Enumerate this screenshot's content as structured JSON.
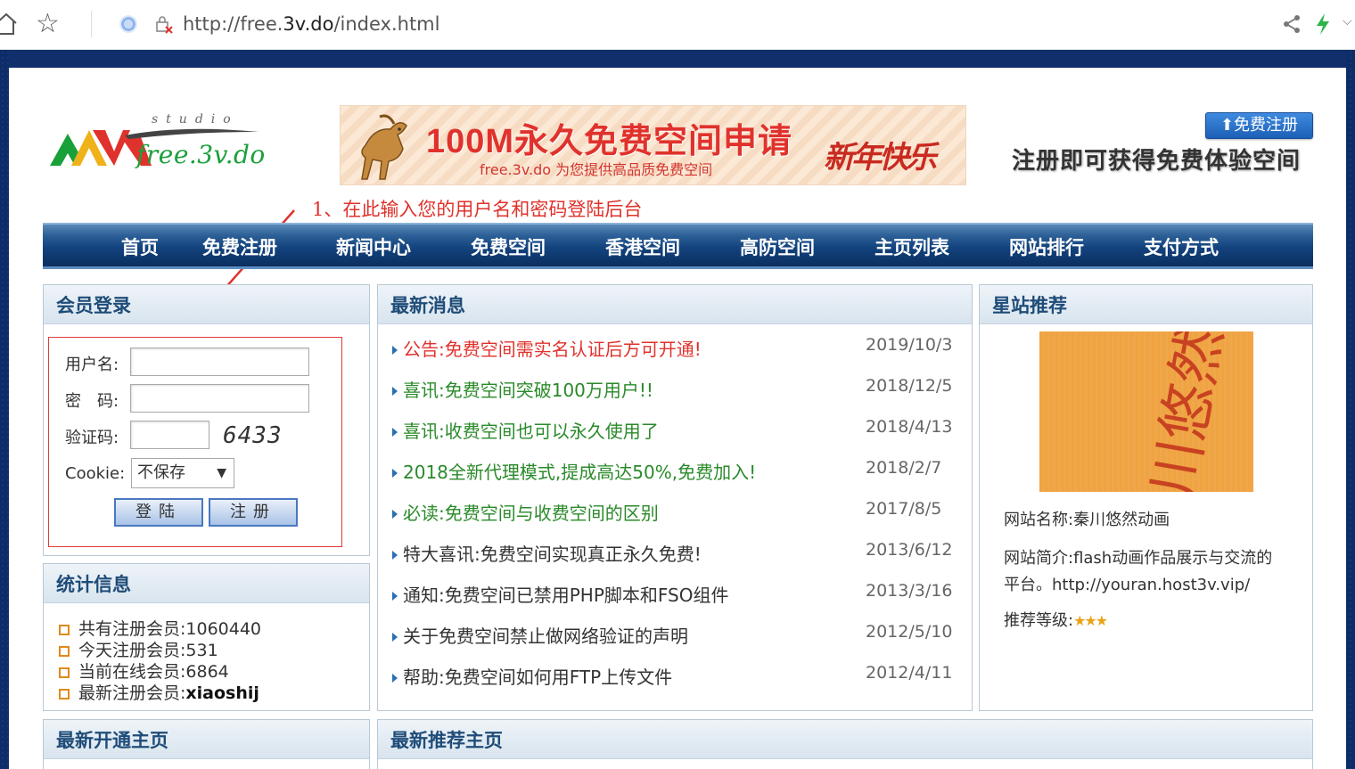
{
  "browser": {
    "url_prefix": "http://free.",
    "url_host": "3v.do",
    "url_path": "/index.html"
  },
  "header": {
    "logo_studio": "studio",
    "logo_text": "free.3v.do",
    "banner_title": "100M永久免费空间申请",
    "banner_sub": "free.3v.do 为您提供高品质免费空间",
    "banner_fest": "新年快乐",
    "register_button": "免费注册",
    "register_tagline": "注册即可获得免费体验空间"
  },
  "annotation": "1、在此输入您的用户名和密码登陆后台",
  "nav": [
    "首页",
    "免费注册",
    "新闻中心",
    "免费空间",
    "香港空间",
    "高防空间",
    "主页列表",
    "网站排行",
    "支付方式"
  ],
  "login": {
    "title": "会员登录",
    "username_label": "用户名:",
    "password_label": "密　码:",
    "captcha_label": "验证码:",
    "captcha_text": "6433",
    "cookie_label": "Cookie:",
    "cookie_value": "不保存",
    "login_button": "登陆",
    "register_button": "注册"
  },
  "stats": {
    "title": "统计信息",
    "rows": [
      {
        "label": "共有注册会员:",
        "value": "1060440"
      },
      {
        "label": "今天注册会员:",
        "value": "531"
      },
      {
        "label": "当前在线会员:",
        "value": "6864"
      },
      {
        "label": "最新注册会员:",
        "value": "xiaoshij"
      }
    ]
  },
  "news": {
    "title": "最新消息",
    "items": [
      {
        "text": "公告:免费空间需实名认证后方可开通!",
        "date": "2019/10/3",
        "color": "#e0322c"
      },
      {
        "text": "喜讯:免费空间突破100万用户!!",
        "date": "2018/12/5",
        "color": "#2a8a2a"
      },
      {
        "text": "喜讯:收费空间也可以永久使用了",
        "date": "2018/4/13",
        "color": "#2a8a2a"
      },
      {
        "text": "2018全新代理模式,提成高达50%,免费加入!",
        "date": "2018/2/7",
        "color": "#2a8a2a"
      },
      {
        "text": "必读:免费空间与收费空间的区别",
        "date": "2017/8/5",
        "color": "#2a8a2a"
      },
      {
        "text": "特大喜讯:免费空间实现真正永久免费!",
        "date": "2013/6/12",
        "color": "#333333"
      },
      {
        "text": "通知:免费空间已禁用PHP脚本和FSO组件",
        "date": "2013/3/16",
        "color": "#333333"
      },
      {
        "text": "关于免费空间禁止做网络验证的声明",
        "date": "2012/5/10",
        "color": "#333333"
      },
      {
        "text": "帮助:免费空间如何用FTP上传文件",
        "date": "2012/4/11",
        "color": "#333333"
      }
    ]
  },
  "star_site": {
    "title": "星站推荐",
    "image_text": "秦川悠然",
    "name_line": "网站名称:秦川悠然动画",
    "intro_line1": "网站简介:flash动画作品展示与交流的",
    "intro_line2": "平台。http://youran.host3v.vip/",
    "rating_label": "推荐等级:",
    "rating_stars": "★★★"
  },
  "bottom": {
    "latest_open": "最新开通主页",
    "latest_recommend": "最新推荐主页"
  },
  "colors": {
    "nav_dark": "#0b2f5f",
    "page_bg": "#0d2d6a",
    "panel_title": "#1f4c78",
    "red": "#e0322c",
    "green": "#2a8a2a"
  }
}
